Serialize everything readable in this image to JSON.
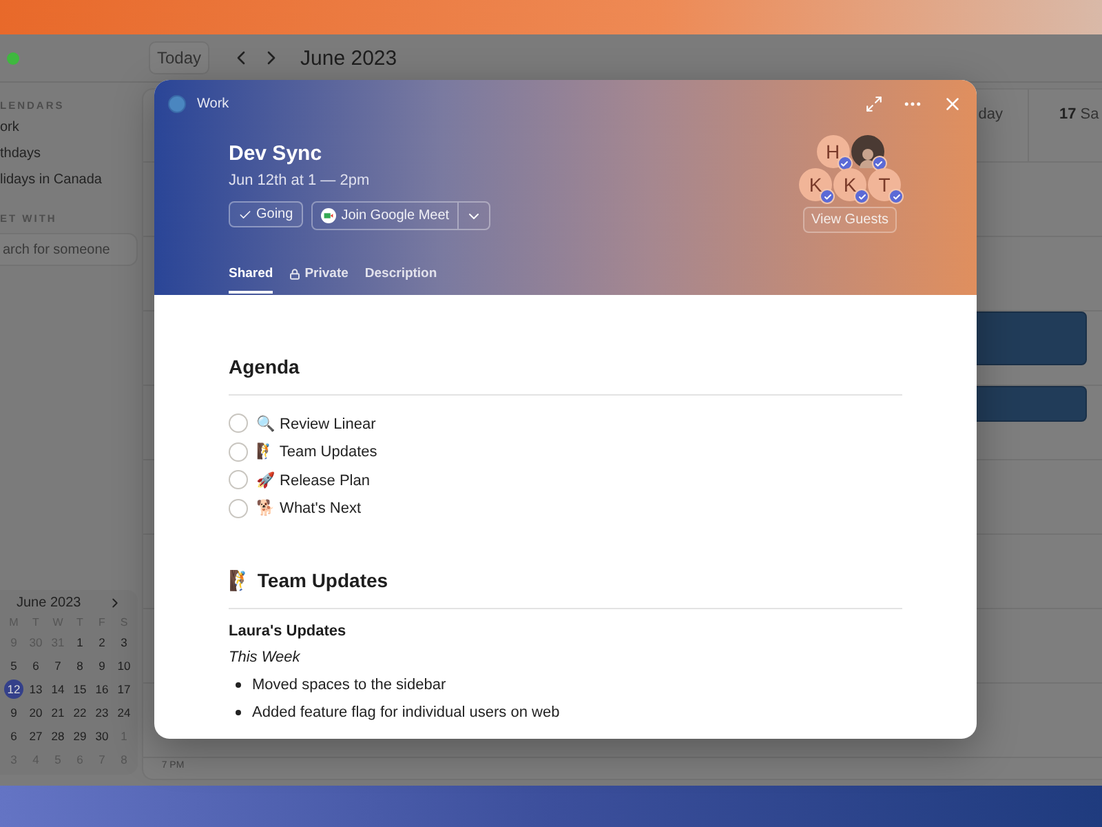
{
  "toolbar": {
    "today_button": "Today",
    "title": "June 2023"
  },
  "sidebar": {
    "calendars_heading": "LENDARS",
    "calendars": [
      {
        "name": "ork"
      },
      {
        "name": "thdays"
      },
      {
        "name": "lidays in Canada"
      }
    ],
    "meet_heading": "ET WITH",
    "search": {
      "placeholder": "arch for someone"
    },
    "mini_calendar": {
      "title": "June 2023",
      "weekdays": [
        "M",
        "T",
        "W",
        "T",
        "F",
        "S"
      ],
      "weeks": [
        [
          {
            "day": "9",
            "in_month": false,
            "selected": false
          },
          {
            "day": "30",
            "in_month": false,
            "selected": false
          },
          {
            "day": "31",
            "in_month": false,
            "selected": false
          },
          {
            "day": "1",
            "in_month": true,
            "selected": false
          },
          {
            "day": "2",
            "in_month": true,
            "selected": false
          },
          {
            "day": "3",
            "in_month": true,
            "selected": false
          }
        ],
        [
          {
            "day": "5",
            "in_month": true,
            "selected": false
          },
          {
            "day": "6",
            "in_month": true,
            "selected": false
          },
          {
            "day": "7",
            "in_month": true,
            "selected": false
          },
          {
            "day": "8",
            "in_month": true,
            "selected": false
          },
          {
            "day": "9",
            "in_month": true,
            "selected": false
          },
          {
            "day": "10",
            "in_month": true,
            "selected": false
          }
        ],
        [
          {
            "day": "12",
            "in_month": true,
            "selected": true
          },
          {
            "day": "13",
            "in_month": true,
            "selected": false
          },
          {
            "day": "14",
            "in_month": true,
            "selected": false
          },
          {
            "day": "15",
            "in_month": true,
            "selected": false
          },
          {
            "day": "16",
            "in_month": true,
            "selected": false
          },
          {
            "day": "17",
            "in_month": true,
            "selected": false
          }
        ],
        [
          {
            "day": "9",
            "in_month": true,
            "selected": false
          },
          {
            "day": "20",
            "in_month": true,
            "selected": false
          },
          {
            "day": "21",
            "in_month": true,
            "selected": false
          },
          {
            "day": "22",
            "in_month": true,
            "selected": false
          },
          {
            "day": "23",
            "in_month": true,
            "selected": false
          },
          {
            "day": "24",
            "in_month": true,
            "selected": false
          }
        ],
        [
          {
            "day": "6",
            "in_month": true,
            "selected": false
          },
          {
            "day": "27",
            "in_month": true,
            "selected": false
          },
          {
            "day": "28",
            "in_month": true,
            "selected": false
          },
          {
            "day": "29",
            "in_month": true,
            "selected": false
          },
          {
            "day": "30",
            "in_month": true,
            "selected": false
          },
          {
            "day": "1",
            "in_month": false,
            "selected": false
          }
        ],
        [
          {
            "day": "3",
            "in_month": false,
            "selected": false
          },
          {
            "day": "4",
            "in_month": false,
            "selected": false
          },
          {
            "day": "5",
            "in_month": false,
            "selected": false
          },
          {
            "day": "6",
            "in_month": false,
            "selected": false
          },
          {
            "day": "7",
            "in_month": false,
            "selected": false
          },
          {
            "day": "8",
            "in_month": false,
            "selected": false
          }
        ]
      ]
    }
  },
  "calendar": {
    "day_headers": [
      {
        "name": "day"
      },
      {
        "number": "17",
        "name": "Sa"
      }
    ],
    "time_label": "7 PM"
  },
  "event": {
    "calendar": "Work",
    "title": "Dev Sync",
    "when": "Jun 12th at 1 — 2pm",
    "going_button": "Going",
    "meet_button": "Join Google Meet",
    "tabs": [
      {
        "label": "Shared",
        "kind": "plain",
        "selected": true
      },
      {
        "label": "Private",
        "kind": "locked",
        "selected": false
      },
      {
        "label": "Description",
        "kind": "plain",
        "selected": false
      }
    ],
    "guests": [
      {
        "kind": "initial",
        "initial": "H",
        "accepted": true
      },
      {
        "kind": "photo",
        "accepted": true
      },
      {
        "kind": "initial",
        "initial": "K",
        "accepted": true
      },
      {
        "kind": "initial",
        "initial": "K",
        "accepted": true
      },
      {
        "kind": "initial",
        "initial": "T",
        "accepted": true
      }
    ],
    "view_guests_button": "View Guests",
    "agenda_heading": "Agenda",
    "agenda": [
      {
        "label": "🔍 Review Linear",
        "checked": false
      },
      {
        "label": "🧗 Team Updates",
        "checked": false
      },
      {
        "label": "🚀 Release Plan",
        "checked": false
      },
      {
        "label": "🐕 What's Next",
        "checked": false
      }
    ],
    "section_heading": "🧗 Team Updates",
    "subheading": "Laura's Updates",
    "week_label": "This Week",
    "bullets": [
      "Moved spaces to the sidebar",
      "Added feature flag for individual users on web"
    ]
  }
}
